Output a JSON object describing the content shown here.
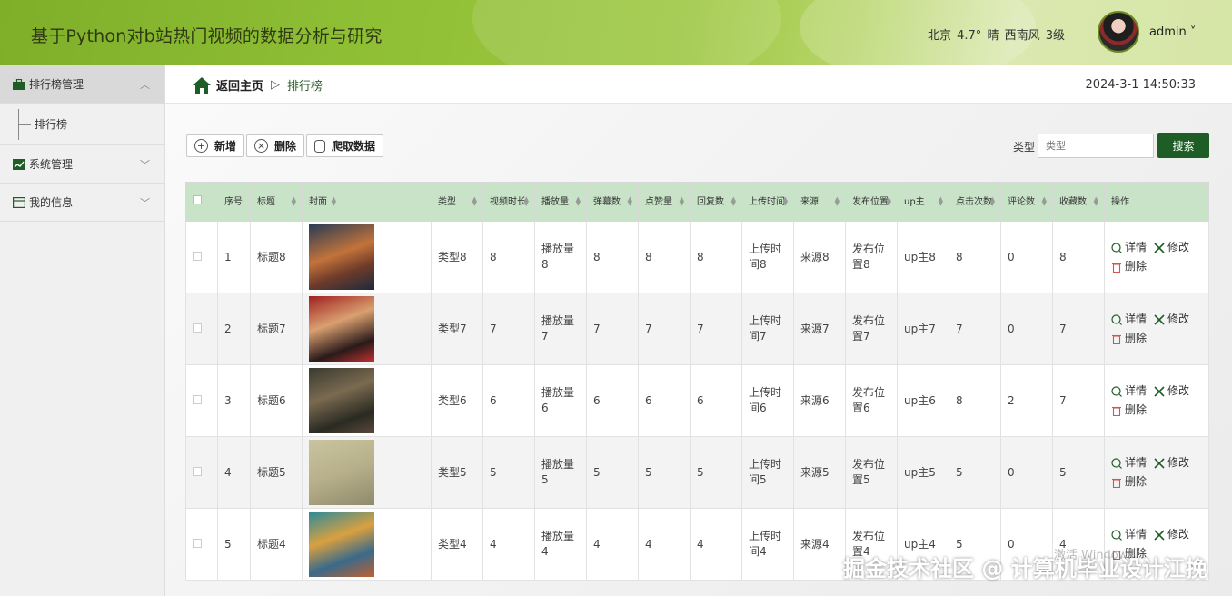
{
  "header": {
    "title": "基于Python对b站热门视频的数据分析与研究",
    "weather": "北京 4.7° 晴 西南风 3级",
    "user": "admin ˅"
  },
  "sidebar": {
    "groups": [
      {
        "label": "排行榜管理",
        "chevron": "︿",
        "icon": "briefcase-icon"
      },
      {
        "label": "系统管理",
        "chevron": "﹀",
        "icon": "chart-icon"
      },
      {
        "label": "我的信息",
        "chevron": "﹀",
        "icon": "id-card-icon"
      }
    ],
    "sub_items": [
      {
        "label": "排行榜"
      }
    ]
  },
  "breadcrumb": {
    "home": "返回主页",
    "sep": "▷",
    "current": "排行榜"
  },
  "clock": "2024-3-1 14:50:33",
  "toolbar": {
    "add_label": "新增",
    "delete_label": "删除",
    "crawl_label": "爬取数据",
    "search_label": "类型",
    "search_placeholder": "类型",
    "search_button": "搜索"
  },
  "table": {
    "columns": [
      "序号",
      "标题",
      "封面",
      "类型",
      "视频时长",
      "播放量",
      "弹幕数",
      "点赞量",
      "回复数",
      "上传时间",
      "来源",
      "发布位置",
      "up主",
      "点击次数",
      "评论数",
      "收藏数",
      "操作"
    ],
    "rows": [
      {
        "idx": "1",
        "title": "标题8",
        "type": "类型8",
        "duration": "8",
        "plays": "播放量8",
        "danmu": "8",
        "likes": "8",
        "replies": "8",
        "upload": "上传时间8",
        "source": "来源8",
        "pos": "发布位置8",
        "up": "up主8",
        "clicks": "8",
        "comments": "0",
        "fav": "8"
      },
      {
        "idx": "2",
        "title": "标题7",
        "type": "类型7",
        "duration": "7",
        "plays": "播放量7",
        "danmu": "7",
        "likes": "7",
        "replies": "7",
        "upload": "上传时间7",
        "source": "来源7",
        "pos": "发布位置7",
        "up": "up主7",
        "clicks": "7",
        "comments": "0",
        "fav": "7"
      },
      {
        "idx": "3",
        "title": "标题6",
        "type": "类型6",
        "duration": "6",
        "plays": "播放量6",
        "danmu": "6",
        "likes": "6",
        "replies": "6",
        "upload": "上传时间6",
        "source": "来源6",
        "pos": "发布位置6",
        "up": "up主6",
        "clicks": "8",
        "comments": "2",
        "fav": "7"
      },
      {
        "idx": "4",
        "title": "标题5",
        "type": "类型5",
        "duration": "5",
        "plays": "播放量5",
        "danmu": "5",
        "likes": "5",
        "replies": "5",
        "upload": "上传时间5",
        "source": "来源5",
        "pos": "发布位置5",
        "up": "up主5",
        "clicks": "5",
        "comments": "0",
        "fav": "5"
      },
      {
        "idx": "5",
        "title": "标题4",
        "type": "类型4",
        "duration": "4",
        "plays": "播放量4",
        "danmu": "4",
        "likes": "4",
        "replies": "4",
        "upload": "上传时间4",
        "source": "来源4",
        "pos": "发布位置4",
        "up": "up主4",
        "clicks": "5",
        "comments": "0",
        "fav": "4"
      }
    ],
    "ops": {
      "detail": "详情",
      "edit": "修改",
      "delete": "删除"
    }
  },
  "colors": {
    "accent": "#1e5e26",
    "header_green": "#8fbf35",
    "table_header": "#c8e3c8"
  },
  "watermark": "掘金技术社区 @ 计算机毕业设计江挽",
  "activate_text": "激活 Windows"
}
